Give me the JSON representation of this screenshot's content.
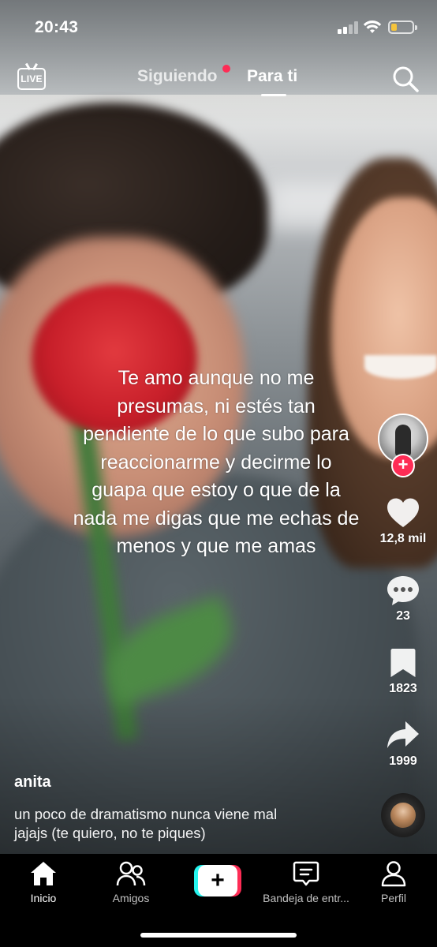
{
  "status_bar": {
    "time": "20:43"
  },
  "top_nav": {
    "live_label": "LIVE",
    "following_label": "Siguiendo",
    "for_you_label": "Para ti"
  },
  "overlay": {
    "text": "Te amo aunque no me presumas, ni estés tan pendiente de lo que subo para reaccionarme y decirme lo guapa que estoy o que de la nada me digas que me echas de menos y que me amas"
  },
  "actions": {
    "likes": "12,8 mil",
    "comments": "23",
    "saves": "1823",
    "shares": "1999"
  },
  "post": {
    "username": "anita",
    "caption_line1": "un poco de dramatismo nunca viene mal",
    "caption_line2": "jajajs (te quiero, no te piques)"
  },
  "bottom_nav": {
    "home": "Inicio",
    "friends": "Amigos",
    "inbox": "Bandeja de entr...",
    "profile": "Perfil"
  },
  "colors": {
    "accent_red": "#fe2c55",
    "accent_cyan": "#25f4ee",
    "battery": "#f5c43b"
  },
  "icons": [
    "live-icon",
    "search-icon",
    "heart-icon",
    "comment-icon",
    "bookmark-icon",
    "share-icon",
    "home-icon",
    "friends-icon",
    "plus-icon",
    "inbox-icon",
    "profile-icon"
  ]
}
